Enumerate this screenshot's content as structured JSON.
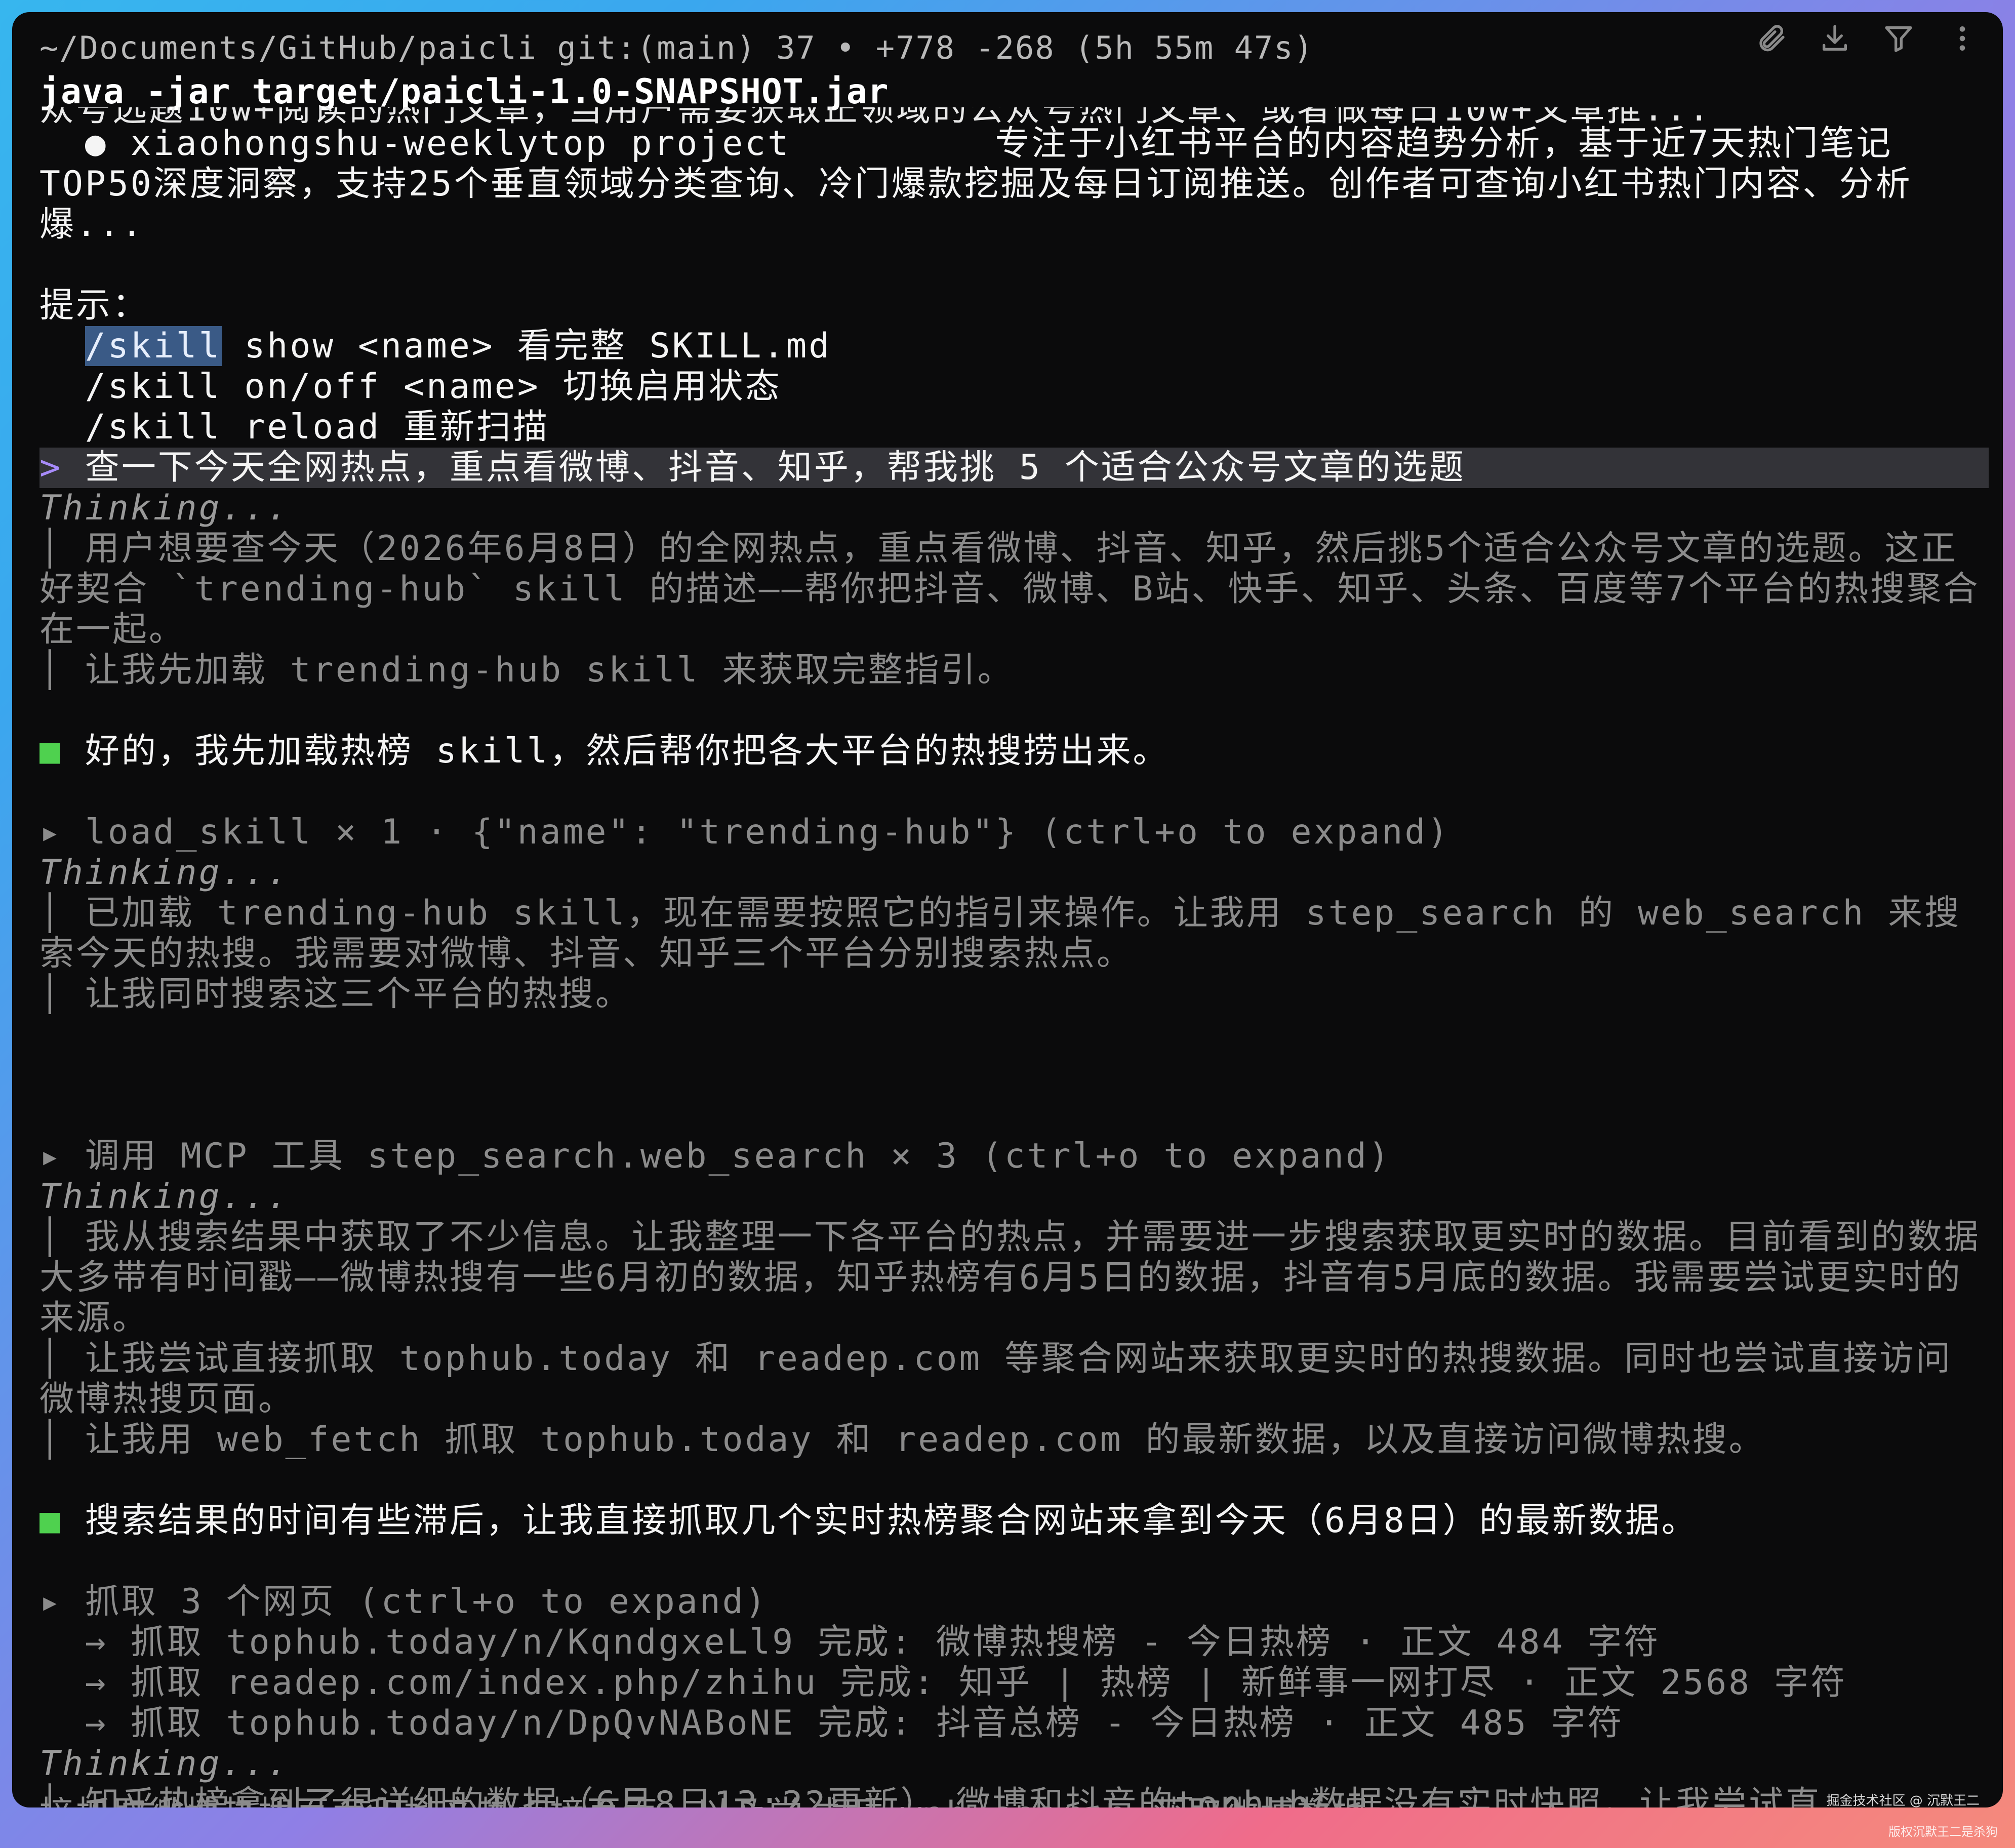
{
  "terminal": {
    "cwd_line": "~/Documents/GitHub/paicli git:(main) 37 • +778 -268 (5h 55m 47s)",
    "command": "java -jar target/paicli-1.0-SNAPSHOT.jar",
    "toolbar_icons": [
      "paperclip-icon",
      "download-icon",
      "filter-icon",
      "more-vertical-icon"
    ],
    "clipped_top_text": "众号选题10w+阅读的热门文章，当用户需要获取正领域的公众号热门文章、或者做每日10w+文章推...",
    "clipped_bottom_text": "接抓取微博热搜页面和抖音热点榜页面，以及尝试用 web_search 获取微博数据。"
  },
  "lines": [
    {
      "kind": "text",
      "text": "  ● xiaohongshu-weeklytop project         专注于小红书平台的内容趋势分析，基于近7天热门笔记TOP50深度洞察，支持25个垂直领域分类查询、冷门爆款挖掘及每日订阅推送。创作者可查询小红书热门内容、分析爆..."
    },
    {
      "kind": "blank",
      "text": ""
    },
    {
      "kind": "text",
      "text": "提示："
    },
    {
      "kind": "hint_sel",
      "sel": "/skill",
      "rest": " show <name> 看完整 SKILL.md"
    },
    {
      "kind": "text",
      "text": "  /skill on/off <name> 切换启用状态"
    },
    {
      "kind": "text",
      "text": "  /skill reload 重新扫描"
    },
    {
      "kind": "prompt",
      "mark": "> ",
      "text": "查一下今天全网热点，重点看微博、抖音、知乎，帮我挑 5 个适合公众号文章的选题"
    },
    {
      "kind": "thinking",
      "text": "Thinking..."
    },
    {
      "kind": "dim",
      "text": "│ 用户想要查今天（2026年6月8日）的全网热点，重点看微博、抖音、知乎，然后挑5个适合公众号文章的选题。这正好契合 `trending-hub` skill 的描述——帮你把抖音、微博、B站、快手、知乎、头条、百度等7个平台的热搜聚合在一起。"
    },
    {
      "kind": "dim",
      "text": "│ 让我先加载 trending-hub skill 来获取完整指引。"
    },
    {
      "kind": "blank",
      "text": ""
    },
    {
      "kind": "green",
      "mark": "■ ",
      "text": "好的，我先加载热榜 skill，然后帮你把各大平台的热搜捞出来。"
    },
    {
      "kind": "blank",
      "text": ""
    },
    {
      "kind": "dim",
      "text": "▸ load_skill × 1 · {\"name\": \"trending-hub\"} (ctrl+o to expand)"
    },
    {
      "kind": "thinking",
      "text": "Thinking..."
    },
    {
      "kind": "dim",
      "text": "│ 已加载 trending-hub skill，现在需要按照它的指引来操作。让我用 step_search 的 web_search 来搜索今天的热搜。我需要对微博、抖音、知乎三个平台分别搜索热点。"
    },
    {
      "kind": "dim",
      "text": "│ 让我同时搜索这三个平台的热搜。"
    },
    {
      "kind": "blank",
      "text": ""
    },
    {
      "kind": "blank",
      "text": ""
    },
    {
      "kind": "blank",
      "text": ""
    },
    {
      "kind": "dim",
      "text": "▸ 调用 MCP 工具 step_search.web_search × 3 (ctrl+o to expand)"
    },
    {
      "kind": "thinking",
      "text": "Thinking..."
    },
    {
      "kind": "dim",
      "text": "│ 我从搜索结果中获取了不少信息。让我整理一下各平台的热点，并需要进一步搜索获取更实时的数据。目前看到的数据大多带有时间戳——微博热搜有一些6月初的数据，知乎热榜有6月5日的数据，抖音有5月底的数据。我需要尝试更实时的来源。"
    },
    {
      "kind": "dim",
      "text": "│ 让我尝试直接抓取 tophub.today 和 readep.com 等聚合网站来获取更实时的热搜数据。同时也尝试直接访问微博热搜页面。"
    },
    {
      "kind": "dim",
      "text": "│ 让我用 web_fetch 抓取 tophub.today 和 readep.com 的最新数据，以及直接访问微博热搜。"
    },
    {
      "kind": "blank",
      "text": ""
    },
    {
      "kind": "green",
      "mark": "■ ",
      "text": "搜索结果的时间有些滞后，让我直接抓取几个实时热榜聚合网站来拿到今天（6月8日）的最新数据。"
    },
    {
      "kind": "blank",
      "text": ""
    },
    {
      "kind": "dim",
      "text": "▸ 抓取 3 个网页 (ctrl+o to expand)"
    },
    {
      "kind": "dim",
      "text": "  → 抓取 tophub.today/n/KqndgxeLl9 完成: 微博热搜榜 - 今日热榜 · 正文 484 字符"
    },
    {
      "kind": "dim",
      "text": "  → 抓取 readep.com/index.php/zhihu 完成: 知乎 | 热榜 | 新鲜事一网打尽 · 正文 2568 字符"
    },
    {
      "kind": "dim",
      "text": "  → 抓取 tophub.today/n/DpQvNABoNE 完成: 抖音总榜 - 今日热榜 · 正文 485 字符"
    },
    {
      "kind": "thinking",
      "text": "Thinking..."
    },
    {
      "kind": "dim",
      "text": "│ 知乎热榜拿到了很详细的数据（6月8日13:22更新）。微博和抖音的tophub数据没有实时快照。让我尝试直"
    }
  ],
  "watermark": {
    "line1": "掘金技术社区 @ 沉默王二",
    "line2": "版权沉默王二是杀狗"
  }
}
